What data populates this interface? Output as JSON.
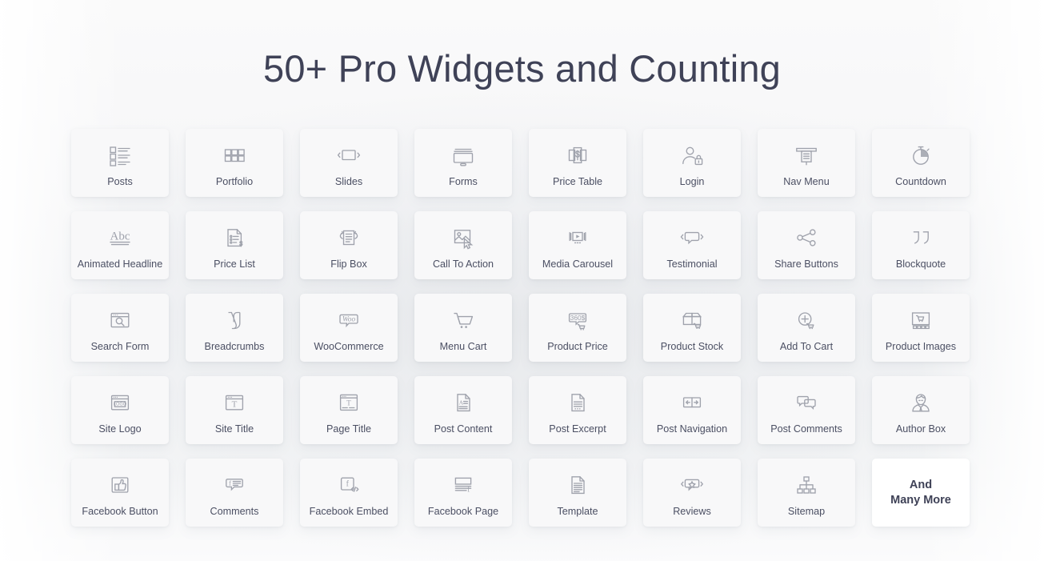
{
  "header": {
    "title": "50+ Pro Widgets and Counting"
  },
  "colors": {
    "title_text": "#3f4257",
    "card_background": "#f8f8f9",
    "card_highlight_background": "#ffffff",
    "icon_stroke": "#9fa2ac",
    "caption_text": "#4b4f63",
    "page_background": "#f4f5f6"
  },
  "grid": {
    "columns": 8,
    "rows": 5,
    "widgets": [
      {
        "label": "Posts",
        "icon": "list-blocks-icon"
      },
      {
        "label": "Portfolio",
        "icon": "grid-squares-icon"
      },
      {
        "label": "Slides",
        "icon": "slider-arrows-icon"
      },
      {
        "label": "Forms",
        "icon": "monitor-form-icon"
      },
      {
        "label": "Price Table",
        "icon": "price-table-dollar-icon"
      },
      {
        "label": "Login",
        "icon": "user-lock-icon"
      },
      {
        "label": "Nav Menu",
        "icon": "nav-menu-icon"
      },
      {
        "label": "Countdown",
        "icon": "stopwatch-icon"
      },
      {
        "label": "Animated Headline",
        "icon": "abc-underline-icon"
      },
      {
        "label": "Price List",
        "icon": "price-list-document-icon"
      },
      {
        "label": "Flip Box",
        "icon": "flip-box-icon"
      },
      {
        "label": "Call To Action",
        "icon": "image-cursor-icon"
      },
      {
        "label": "Media Carousel",
        "icon": "media-carousel-icon"
      },
      {
        "label": "Testimonial",
        "icon": "speech-bubble-arrows-icon"
      },
      {
        "label": "Share Buttons",
        "icon": "share-nodes-icon"
      },
      {
        "label": "Blockquote",
        "icon": "quotation-marks-icon"
      },
      {
        "label": "Search Form",
        "icon": "browser-search-icon"
      },
      {
        "label": "Breadcrumbs",
        "icon": "yoast-y-icon"
      },
      {
        "label": "WooCommerce",
        "icon": "woo-bubble-icon"
      },
      {
        "label": "Menu Cart",
        "icon": "shopping-cart-icon"
      },
      {
        "label": "Product Price",
        "icon": "price-tag-360-icon"
      },
      {
        "label": "Product Stock",
        "icon": "open-box-cart-icon"
      },
      {
        "label": "Add To Cart",
        "icon": "plus-circle-cart-icon"
      },
      {
        "label": "Product Images",
        "icon": "product-gallery-icon"
      },
      {
        "label": "Site Logo",
        "icon": "browser-logo-icon"
      },
      {
        "label": "Site Title",
        "icon": "browser-title-icon"
      },
      {
        "label": "Page Title",
        "icon": "browser-page-title-icon"
      },
      {
        "label": "Post Content",
        "icon": "document-text-a-icon"
      },
      {
        "label": "Post Excerpt",
        "icon": "document-excerpt-icon"
      },
      {
        "label": "Post Navigation",
        "icon": "prev-next-arrows-icon"
      },
      {
        "label": "Post Comments",
        "icon": "two-speech-bubbles-icon"
      },
      {
        "label": "Author Box",
        "icon": "author-avatar-icon"
      },
      {
        "label": "Facebook Button",
        "icon": "thumbs-up-square-icon"
      },
      {
        "label": "Comments",
        "icon": "facebook-comment-bubble-icon"
      },
      {
        "label": "Facebook Embed",
        "icon": "facebook-code-embed-icon"
      },
      {
        "label": "Facebook Page",
        "icon": "facebook-page-icon"
      },
      {
        "label": "Template",
        "icon": "document-lines-icon"
      },
      {
        "label": "Reviews",
        "icon": "star-bubble-icon"
      },
      {
        "label": "Sitemap",
        "icon": "sitemap-tree-icon"
      },
      {
        "label": "And\nMany More",
        "icon": "none",
        "highlight": true
      }
    ]
  }
}
